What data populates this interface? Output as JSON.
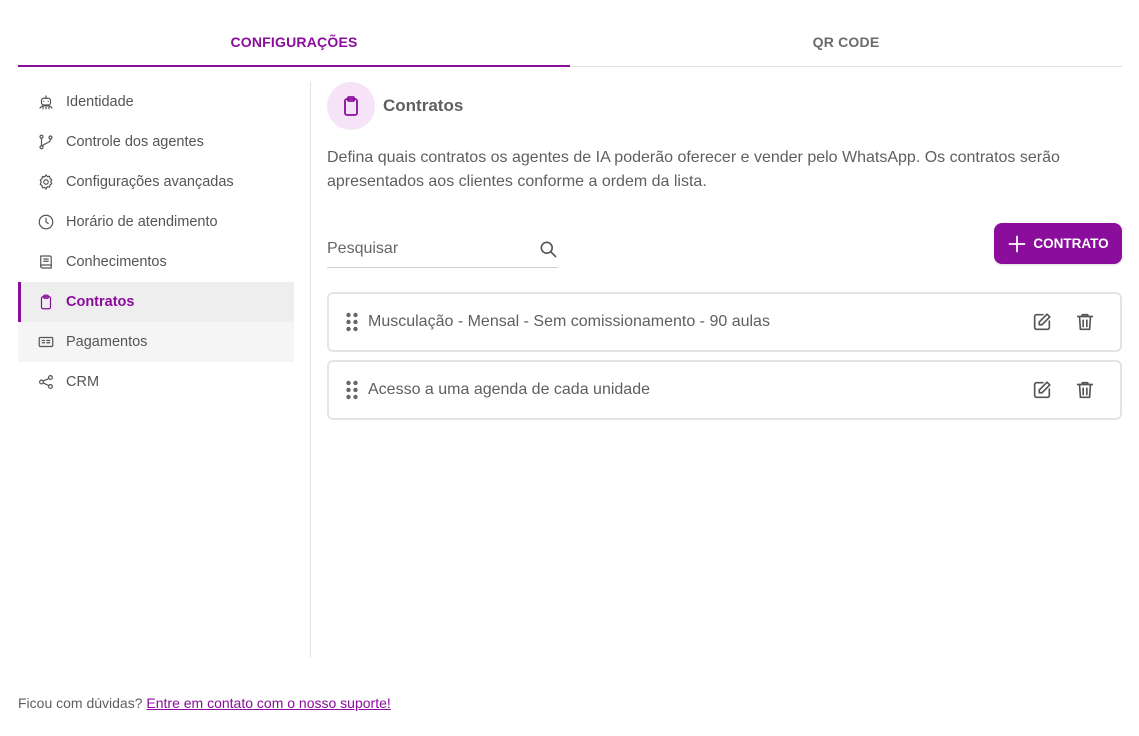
{
  "tabs": [
    {
      "label": "CONFIGURAÇÕES",
      "active": true
    },
    {
      "label": "QR CODE",
      "active": false
    }
  ],
  "sidebar": {
    "items": [
      {
        "label": "Identidade",
        "icon": "robot-icon"
      },
      {
        "label": "Controle dos agentes",
        "icon": "git-branch-icon"
      },
      {
        "label": "Configurações avançadas",
        "icon": "gear-icon"
      },
      {
        "label": "Horário de atendimento",
        "icon": "clock-icon"
      },
      {
        "label": "Conhecimentos",
        "icon": "book-icon"
      },
      {
        "label": "Contratos",
        "icon": "clipboard-icon",
        "active": true
      },
      {
        "label": "Pagamentos",
        "icon": "payment-card-icon"
      },
      {
        "label": "CRM",
        "icon": "share-nodes-icon"
      }
    ]
  },
  "main": {
    "title": "Contratos",
    "title_icon": "clipboard-icon",
    "description": "Defina quais contratos os agentes de IA poderão oferecer e vender pelo WhatsApp. Os contratos serão apresentados aos clientes conforme a ordem da lista.",
    "search": {
      "placeholder": "Pesquisar",
      "value": ""
    },
    "add_button_label": "CONTRATO",
    "contracts": [
      {
        "label": "Musculação - Mensal - Sem comissionamento - 90 aulas"
      },
      {
        "label": "Acesso a uma agenda de cada unidade"
      }
    ]
  },
  "footer": {
    "text": "Ficou com dúvidas?",
    "link": "Entre em contato com o nosso suporte!"
  },
  "colors": {
    "accent": "#8a0d9c",
    "accent_light": "#f6e3f8",
    "text": "#5f5f5f",
    "border": "#e4e4e4"
  }
}
